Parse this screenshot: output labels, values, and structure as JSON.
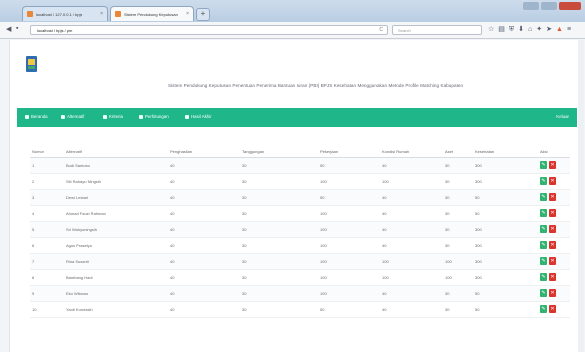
{
  "browser": {
    "tabs": [
      {
        "label": "localhost / 127.0.0.1 / bpjs",
        "color": "#e8863a"
      },
      {
        "label": "Sistem Pendukung Keputusan",
        "color": "#e8863a"
      }
    ],
    "new_tab": "+",
    "url": "localhost / bpjs / pm",
    "search_placeholder": "Search",
    "reload": "C"
  },
  "page": {
    "heading": "Sistem Pendukung Keputusan Penentuan Penerima Bantuan Iuran (PBI) BPJS Kesehatan Menggunakan Metode Profile Matching Kabupaten",
    "menu": [
      "Beranda",
      "Alternatif",
      "Kriteria",
      "Perhitungan",
      "Hasil Akhir"
    ],
    "logout": "Keluar",
    "columns": [
      "Nomor",
      "Alternatif",
      "Penghasilan",
      "Tanggungan",
      "Pekerjaan",
      "Kondisi Rumah",
      "Aset",
      "Kesehatan",
      "Aksi"
    ],
    "rows": [
      {
        "no": "1",
        "name": "Budi Santoso",
        "c1": "40",
        "c2": "30",
        "c3": "50",
        "c4": "40",
        "c5": "30",
        "c6": "300"
      },
      {
        "no": "2",
        "name": "Siti Rahayu Ningsih",
        "c1": "40",
        "c2": "30",
        "c3": "100",
        "c4": "100",
        "c5": "30",
        "c6": "300"
      },
      {
        "no": "3",
        "name": "Dewi Lestari",
        "c1": "40",
        "c2": "30",
        "c3": "50",
        "c4": "40",
        "c5": "30",
        "c6": "50"
      },
      {
        "no": "4",
        "name": "Ahmad Fauzi Rahman",
        "c1": "40",
        "c2": "30",
        "c3": "100",
        "c4": "40",
        "c5": "30",
        "c6": "50"
      },
      {
        "no": "5",
        "name": "Sri Wahyuningsih",
        "c1": "40",
        "c2": "30",
        "c3": "100",
        "c4": "40",
        "c5": "30",
        "c6": "300"
      },
      {
        "no": "6",
        "name": "Agus Prasetyo",
        "c1": "40",
        "c2": "30",
        "c3": "100",
        "c4": "40",
        "c5": "30",
        "c6": "300"
      },
      {
        "no": "7",
        "name": "Rina Susanti",
        "c1": "40",
        "c2": "30",
        "c3": "100",
        "c4": "100",
        "c5": "100",
        "c6": "300"
      },
      {
        "no": "8",
        "name": "Bambang Hadi",
        "c1": "40",
        "c2": "30",
        "c3": "100",
        "c4": "100",
        "c5": "100",
        "c6": "300"
      },
      {
        "no": "9",
        "name": "Eko Wibowo",
        "c1": "40",
        "c2": "30",
        "c3": "100",
        "c4": "40",
        "c5": "30",
        "c6": "50"
      },
      {
        "no": "10",
        "name": "Yanti Kurniasih",
        "c1": "40",
        "c2": "30",
        "c3": "50",
        "c4": "40",
        "c5": "30",
        "c6": "50"
      }
    ],
    "edit_icon": "pencil-icon",
    "delete_icon": "trash-icon",
    "accent": "#1fb68a"
  }
}
